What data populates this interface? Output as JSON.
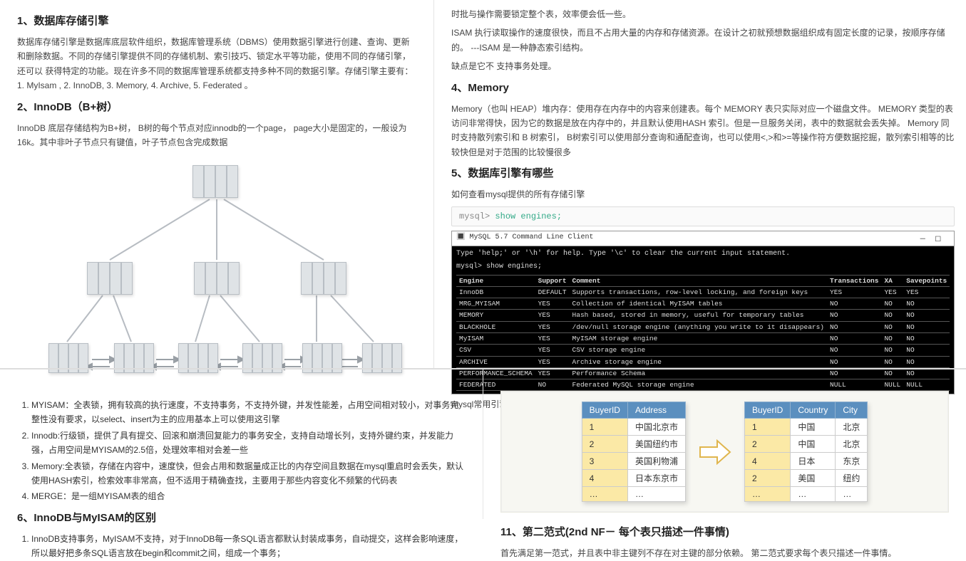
{
  "left_upper": {
    "h1": "1、数据库存储引擎",
    "p1": "数据库存储引擎是数据库底层软件组织，数据库管理系统（DBMS）使用数据引擎进行创建、查询、更新和删除数据。不同的存储引擎提供不同的存储机制、索引技巧、锁定水平等功能，使用不同的存储引擎，还可以 获得特定的功能。现在许多不同的数据库管理系统都支持多种不同的数据引擎。存储引擎主要有：  1. MyIsam , 2. InnoDB, 3. Memory, 4. Archive, 5. Federated 。",
    "h2": "2、InnoDB（B+树）",
    "p2": "InnoDB 底层存储结构为B+树， B树的每个节点对应innodb的一个page， page大小是固定的，一般设为 16k。其中非叶子节点只有键值，叶子节点包含完成数据"
  },
  "right_upper": {
    "p0": "时批与操作需要锁定整个表，效率便会低一些。",
    "p1": "ISAM 执行读取操作的速度很快，而且不占用大量的内存和存储资源。在设计之初就预想数据组织成有固定长度的记录，按顺序存储的。 ---ISAM 是一种静态索引结构。",
    "p2": "缺点是它不 支持事务处理。",
    "h4": "4、Memory",
    "p4": "Memory（也叫 HEAP）堆内存：使用存在内存中的内容来创建表。每个 MEMORY 表只实际对应一个磁盘文件。 MEMORY 类型的表访问非常得快，因为它的数据是放在内存中的，并且默认使用HASH 索引。但是一旦服务关闭，表中的数据就会丢失掉。 Memory 同时支持散列索引和 B 树索引， B树索引可以使用部分查询和通配查询，也可以使用<,>和>=等操作符方便数据挖掘，散列索引相等的比较快但是对于范围的比较慢很多",
    "h5": "5、数据库引擎有哪些",
    "p5": "如何查看mysql提供的所有存储引擎",
    "code_prompt": "mysql> ",
    "code_cmd": "show engines;",
    "term_title": "MySQL 5.7 Command Line Client",
    "term_hint": "Type 'help;' or '\\h' for help. Type '\\c' to clear the current input statement.",
    "term_cmd": "mysql> show engines;",
    "engines_header": [
      "Engine",
      "Support",
      "Comment",
      "Transactions",
      "XA",
      "Savepoints"
    ],
    "engines": [
      [
        "InnoDB",
        "DEFAULT",
        "Supports transactions, row-level locking, and foreign keys",
        "YES",
        "YES",
        "YES"
      ],
      [
        "MRG_MYISAM",
        "YES",
        "Collection of identical MyISAM tables",
        "NO",
        "NO",
        "NO"
      ],
      [
        "MEMORY",
        "YES",
        "Hash based, stored in memory, useful for temporary tables",
        "NO",
        "NO",
        "NO"
      ],
      [
        "BLACKHOLE",
        "YES",
        "/dev/null storage engine (anything you write to it disappears)",
        "NO",
        "NO",
        "NO"
      ],
      [
        "MyISAM",
        "YES",
        "MyISAM storage engine",
        "NO",
        "NO",
        "NO"
      ],
      [
        "CSV",
        "YES",
        "CSV storage engine",
        "NO",
        "NO",
        "NO"
      ],
      [
        "ARCHIVE",
        "YES",
        "Archive storage engine",
        "NO",
        "NO",
        "NO"
      ],
      [
        "PERFORMANCE_SCHEMA",
        "YES",
        "Performance Schema",
        "NO",
        "NO",
        "NO"
      ],
      [
        "FEDERATED",
        "NO",
        "Federated MySQL storage engine",
        "NULL",
        "NULL",
        "NULL"
      ]
    ],
    "p6": "mysql常用引擎包括：MYISAM、Innodb、Memory、MERGE"
  },
  "left_lower": {
    "ol": [
      "MYISAM：全表锁，拥有较高的执行速度，不支持事务，不支持外键，并发性能差，占用空间相对较小，对事务完整性没有要求，以select、insert为主的应用基本上可以使用这引擎",
      "Innodb:行级锁，提供了具有提交、回滚和崩溃回复能力的事务安全，支持自动增长列，支持外键约束，并发能力强，占用空间是MYISAM的2.5倍，处理效率相对会差一些",
      "Memory:全表锁，存储在内容中，速度快，但会占用和数据量成正比的内存空间且数据在mysql重启时会丢失，默认使用HASH索引，检索效率非常高，但不适用于精确查找，主要用于那些内容变化不频繁的代码表",
      "MERGE：是一组MYISAM表的组合"
    ],
    "h6": "6、InnoDB与MyISAM的区别",
    "li1": "InnoDB支持事务，MyISAM不支持，对于InnoDB每一条SQL语言都默认封装成事务，自动提交，这样会影响速度，所以最好把多条SQL语言放在begin和commit之间，组成一个事务；"
  },
  "right_lower": {
    "h11": "11、第二范式(2nd NF－ 每个表只描述一件事情)",
    "p11": "首先满足第一范式，并且表中非主键列不存在对主键的部分依赖。 第二范式要求每个表只描述一件事情。",
    "table1_header": [
      "BuyerID",
      "Address"
    ],
    "table1": [
      [
        "1",
        "中国北京市"
      ],
      [
        "2",
        "美国纽约市"
      ],
      [
        "3",
        "英国利物浦"
      ],
      [
        "4",
        "日本东京市"
      ],
      [
        "…",
        "…"
      ]
    ],
    "table2_header": [
      "BuyerID",
      "Country",
      "City"
    ],
    "table2": [
      [
        "1",
        "中国",
        "北京"
      ],
      [
        "2",
        "中国",
        "北京"
      ],
      [
        "4",
        "日本",
        "东京"
      ],
      [
        "2",
        "美国",
        "纽约"
      ],
      [
        "…",
        "…",
        "…"
      ]
    ]
  }
}
